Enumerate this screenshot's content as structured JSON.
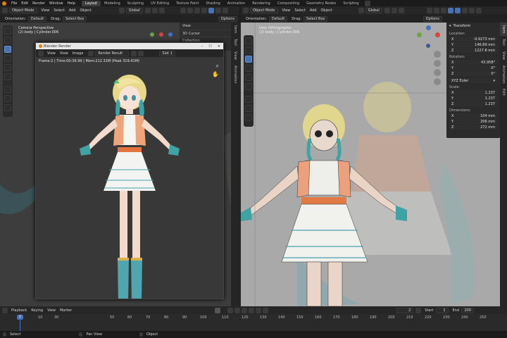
{
  "menu": {
    "items": [
      "File",
      "Edit",
      "Render",
      "Window",
      "Help"
    ]
  },
  "workspaces": {
    "tabs": [
      "Layout",
      "Modeling",
      "Sculpting",
      "UV Editing",
      "Texture Paint",
      "Shading",
      "Animation",
      "Rendering",
      "Compositing",
      "Geometry Nodes",
      "Scripting"
    ],
    "active": "Layout"
  },
  "left_vp": {
    "mode": "Object Mode",
    "menus": [
      "View",
      "Select",
      "Add",
      "Object"
    ],
    "transform": "Global",
    "orientation_label": "Orientation:",
    "orientation": "Default",
    "drag_label": "Drag:",
    "drag": "Select Box",
    "options": "Options",
    "title": "Camera Perspective",
    "subtitle": "(2) body | Cylinder.006",
    "sidebar": [
      "View",
      "3D Cursor",
      "Collection"
    ]
  },
  "render_win": {
    "title": "Blender Render",
    "menus": [
      "View",
      "View",
      "Image"
    ],
    "slot_name": "Render Result",
    "slot": "Slot 1",
    "info": "Frame:2 | Time:00:36.99 | Mem:212.31M (Peak 319.41M)"
  },
  "right_vp": {
    "mode": "Object Mode",
    "menus": [
      "View",
      "Select",
      "Add",
      "Object"
    ],
    "transform": "Global",
    "orientation_label": "Orientation:",
    "orientation": "Default",
    "drag_label": "Drag:",
    "drag": "Select Box",
    "options": "Options",
    "title": "User Orthographic",
    "subtitle": "(2) body | Cylinder.006",
    "side_tabs": [
      "Item",
      "Tool",
      "View",
      "Animation",
      "Edit"
    ]
  },
  "transform_panel": {
    "header": "Transform",
    "location_label": "Location:",
    "location": [
      {
        "axis": "X",
        "value": "-9.9273 mm"
      },
      {
        "axis": "Y",
        "value": "146.89 mm"
      },
      {
        "axis": "Z",
        "value": "1227.8 mm"
      }
    ],
    "rotation_label": "Rotation:",
    "rotation": [
      {
        "axis": "X",
        "value": "43.958°"
      },
      {
        "axis": "Y",
        "value": "0°"
      },
      {
        "axis": "Z",
        "value": "0°"
      }
    ],
    "rotation_mode": "XYZ Euler",
    "scale_label": "Scale:",
    "scale": [
      {
        "axis": "X",
        "value": "1.237"
      },
      {
        "axis": "Y",
        "value": "1.237"
      },
      {
        "axis": "Z",
        "value": "1.237"
      }
    ],
    "dimensions_label": "Dimensions:",
    "dimensions": [
      {
        "axis": "X",
        "value": "104 mm"
      },
      {
        "axis": "Y",
        "value": "206 mm"
      },
      {
        "axis": "Z",
        "value": "272 mm"
      }
    ]
  },
  "timeline": {
    "menus": [
      "Playback",
      "Keying",
      "View",
      "Marker"
    ],
    "current_frame": "2",
    "start_label": "Start",
    "start": "1",
    "end_label": "End",
    "end": "200",
    "ruler": [
      "2",
      "10",
      "30",
      "50",
      "60",
      "70",
      "80",
      "90",
      "100",
      "110",
      "120",
      "130",
      "140",
      "150",
      "160",
      "170",
      "180",
      "190",
      "200",
      "210",
      "220",
      "230",
      "240",
      "250"
    ]
  },
  "status": {
    "items": [
      "Select",
      "Pan View",
      "Object"
    ]
  },
  "colors": {
    "accent": "#4772b3",
    "header": "#1b1b1b",
    "viewport_left": "#3d3d3d",
    "viewport_right": "#a9a9a9",
    "render_bg": "#383838"
  }
}
